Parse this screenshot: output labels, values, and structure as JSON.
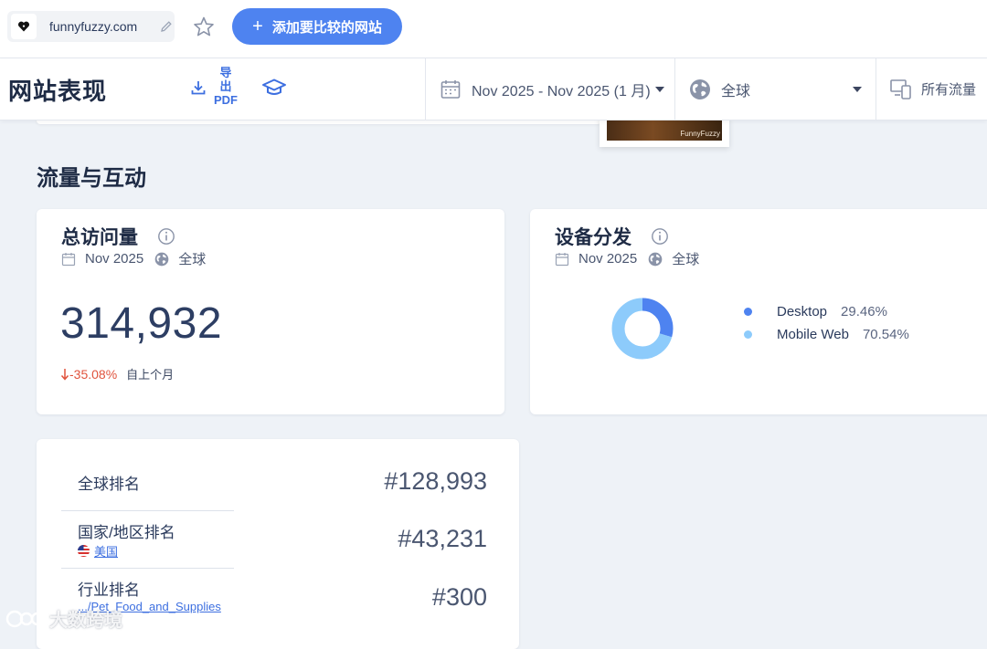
{
  "topbar": {
    "site_name": "funnyfuzzy.com",
    "compare_button": "添加要比较的网站"
  },
  "toolbar": {
    "title": "网站表现",
    "export_line1": "导",
    "export_line2": "出",
    "export_line3": "PDF",
    "date_range": "Nov 2025 - Nov 2025 (1 月)",
    "geo": "全球",
    "traffic": "所有流量"
  },
  "thumbnail": {
    "label": "FunnyFuzzy"
  },
  "section": {
    "title": "流量与互动"
  },
  "visits": {
    "title": "总访问量",
    "date": "Nov 2025",
    "geo": "全球",
    "value": "314,932",
    "change": "-35.08%",
    "change_note": "自上个月"
  },
  "device": {
    "title": "设备分发",
    "date": "Nov 2025",
    "geo": "全球",
    "chart_data": {
      "type": "pie",
      "categories": [
        "Desktop",
        "Mobile Web"
      ],
      "values": [
        29.46,
        70.54
      ],
      "labels": [
        "29.46%",
        "70.54%"
      ],
      "colors": [
        "#4e83f0",
        "#8dcbfb"
      ]
    }
  },
  "rank": {
    "global_label": "全球排名",
    "global_value": "#128,993",
    "country_label": "国家/地区排名",
    "country_name": "美国",
    "country_value": "#43,231",
    "category_label": "行业排名",
    "category_name": ".../Pet_Food_and_Supplies",
    "category_value": "#300"
  },
  "watermark": {
    "text": "大数跨境"
  }
}
